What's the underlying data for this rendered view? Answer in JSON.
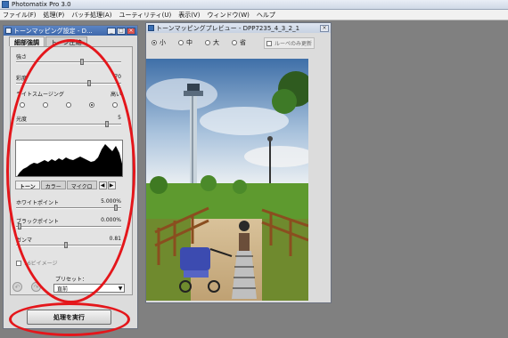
{
  "app": {
    "title": "Photomatix Pro 3.0"
  },
  "menu": [
    "ファイル(F)",
    "処理(P)",
    "バッチ処理(A)",
    "ユーティリティ(U)",
    "表示(V)",
    "ウィンドウ(W)",
    "ヘルプ"
  ],
  "panel": {
    "title": "トーンマッピング設定 - D...",
    "tabs": [
      "細部強調",
      "トーン圧縮"
    ],
    "sliders": [
      {
        "label": "強さ",
        "value": ""
      },
      {
        "label": "彩度",
        "value": "70"
      },
      {
        "label": "ライトスムージング",
        "value": "高い"
      },
      {
        "label": "光度",
        "value": "5"
      }
    ],
    "subtabs": [
      "トーン",
      "カラー",
      "マイクロ"
    ],
    "sub_sliders": [
      {
        "label": "ホワイトポイント",
        "value": "5.000%"
      },
      {
        "label": "ブラックポイント",
        "value": "0.000%"
      },
      {
        "label": "ガンマ",
        "value": "0.81"
      }
    ],
    "checkbox_label": "16ビイメージ",
    "preset_label": "プリセット：",
    "preset_value": "直前",
    "process_button": "処理を実行"
  },
  "preview": {
    "title": "トーンマッピングプレビュー - DPP7235_4_3_2_1",
    "sizes": [
      "小",
      "中",
      "大",
      "省"
    ],
    "loupe_label": "ルーペのみ更新"
  },
  "colors": {
    "annotation": "#e4161b"
  }
}
